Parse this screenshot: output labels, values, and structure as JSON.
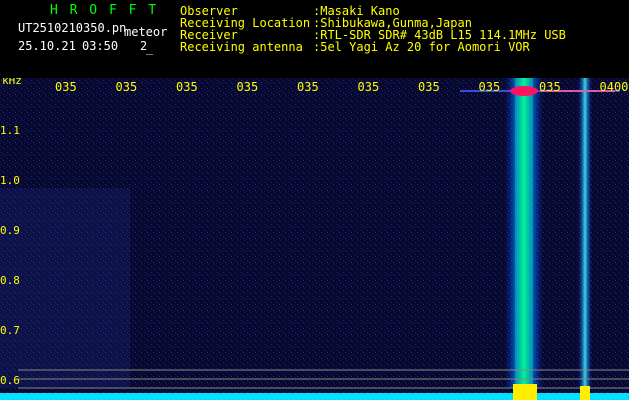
{
  "header": {
    "title": "H R O F F T",
    "filename": "UT2510210350.pn",
    "meteor_label": "meteor",
    "date": "25.10.21",
    "time": "03:50",
    "count": "2",
    "underscore": "_",
    "labels": {
      "observer": "Observer",
      "location": "Receiving Location",
      "receiver": "Receiver",
      "antenna": "Receiving antenna"
    },
    "values": {
      "observer": ":Masaki Kano",
      "location": ":Shibukawa,Gunma,Japan",
      "receiver": ":RTL-SDR SDR# 43dB L15 114.1MHz USB",
      "antenna": ":5el Yagi Az 20 for Aomori VOR"
    }
  },
  "spectrogram": {
    "yunit": "kHz",
    "time_ticks": [
      "035",
      "035",
      "035",
      "035",
      "035",
      "035",
      "035",
      "035",
      "035",
      "0400"
    ],
    "freq_ticks": [
      "1.1",
      "1.0",
      "0.9",
      "0.8",
      "0.7",
      "0.6"
    ],
    "colors": {
      "background": "#0a0a3a",
      "signal": "#00ff80",
      "hot": "#ff1060",
      "baseline": "#00ffff"
    }
  }
}
